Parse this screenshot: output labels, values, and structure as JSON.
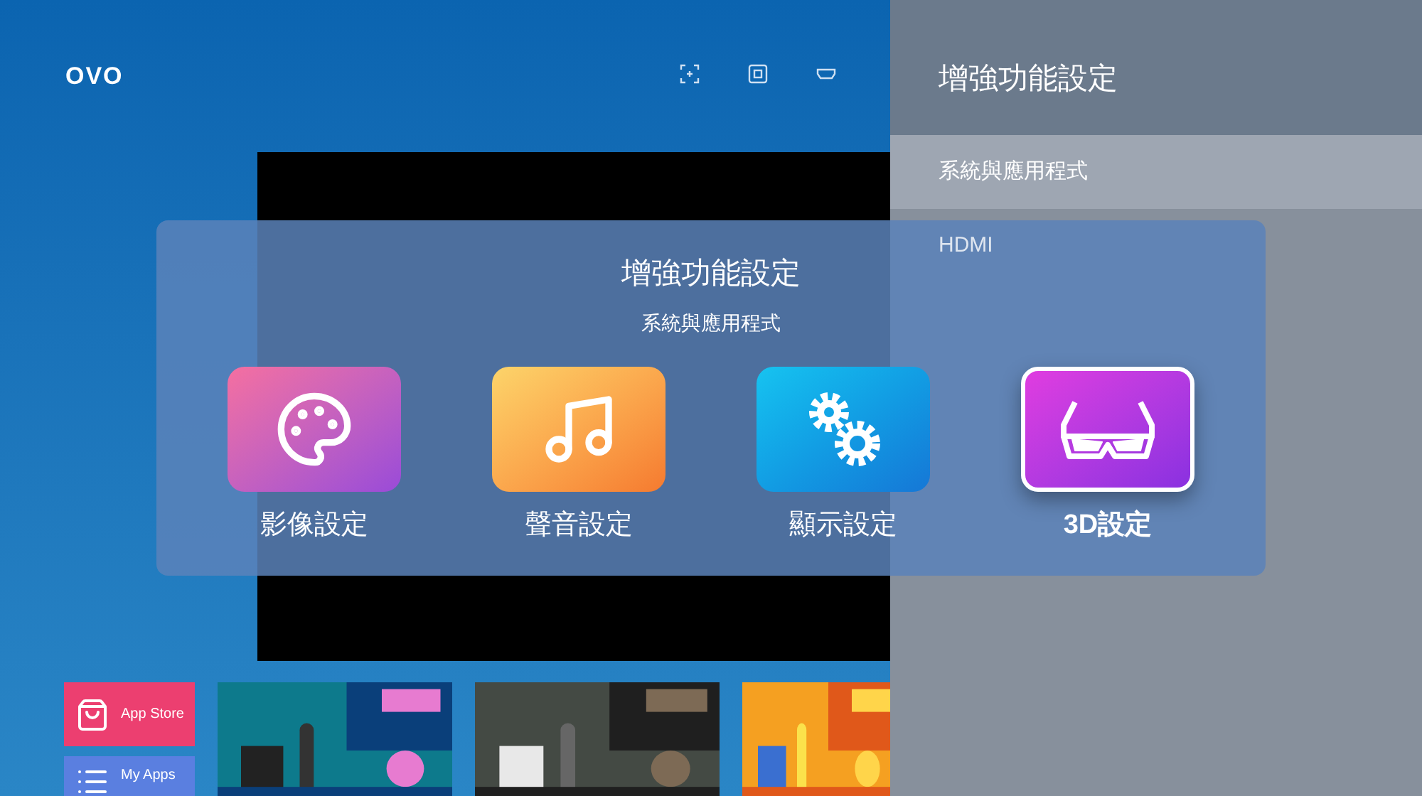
{
  "logo": "OVO",
  "side_panel": {
    "title": "增強功能設定",
    "items": [
      {
        "label": "系統與應用程式",
        "selected": true
      },
      {
        "label": "HDMI",
        "selected": false
      }
    ]
  },
  "dialog": {
    "title": "增強功能設定",
    "subtitle": "系統與應用程式",
    "options": [
      {
        "label": "影像設定",
        "kind": "palette",
        "selected": false
      },
      {
        "label": "聲音設定",
        "kind": "music",
        "selected": false
      },
      {
        "label": "顯示設定",
        "kind": "gears",
        "selected": false
      },
      {
        "label": "3D設定",
        "kind": "glasses",
        "selected": true
      }
    ]
  },
  "shortcuts": [
    {
      "label": "App Store",
      "kind": "store"
    },
    {
      "label": "My Apps",
      "kind": "apps"
    }
  ]
}
